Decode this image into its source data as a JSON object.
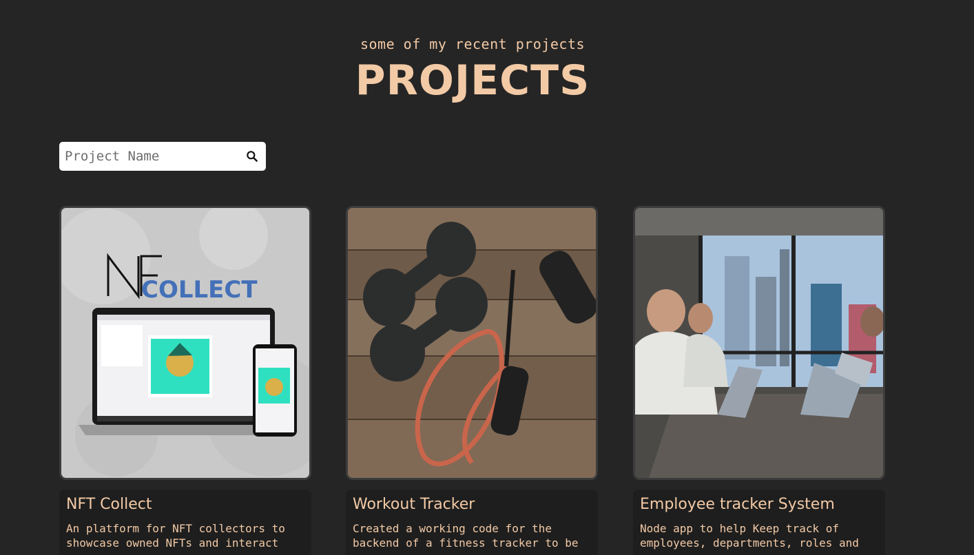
{
  "header": {
    "subtitle": "some of my recent projects",
    "title": "PROJECTS"
  },
  "search": {
    "placeholder": "Project Name",
    "icon": "search-icon"
  },
  "colors": {
    "background": "#252525",
    "accent": "#f3caa6",
    "card_info_bg": "#1e1e1e"
  },
  "projects": [
    {
      "title": "NFT Collect",
      "description": "An platform for NFT collectors to\nshowcase owned NFTs and interact",
      "image": "nft-collect-preview",
      "logo_text": "COLLECT"
    },
    {
      "title": "Workout Tracker",
      "description": "Created a working code for the\nbackend of a fitness tracker to be",
      "image": "dumbbells-and-resistance-band"
    },
    {
      "title": "Employee tracker System",
      "description": "Node app to help Keep track of\nemployees, departments, roles and",
      "image": "office-workers-with-laptops"
    }
  ]
}
